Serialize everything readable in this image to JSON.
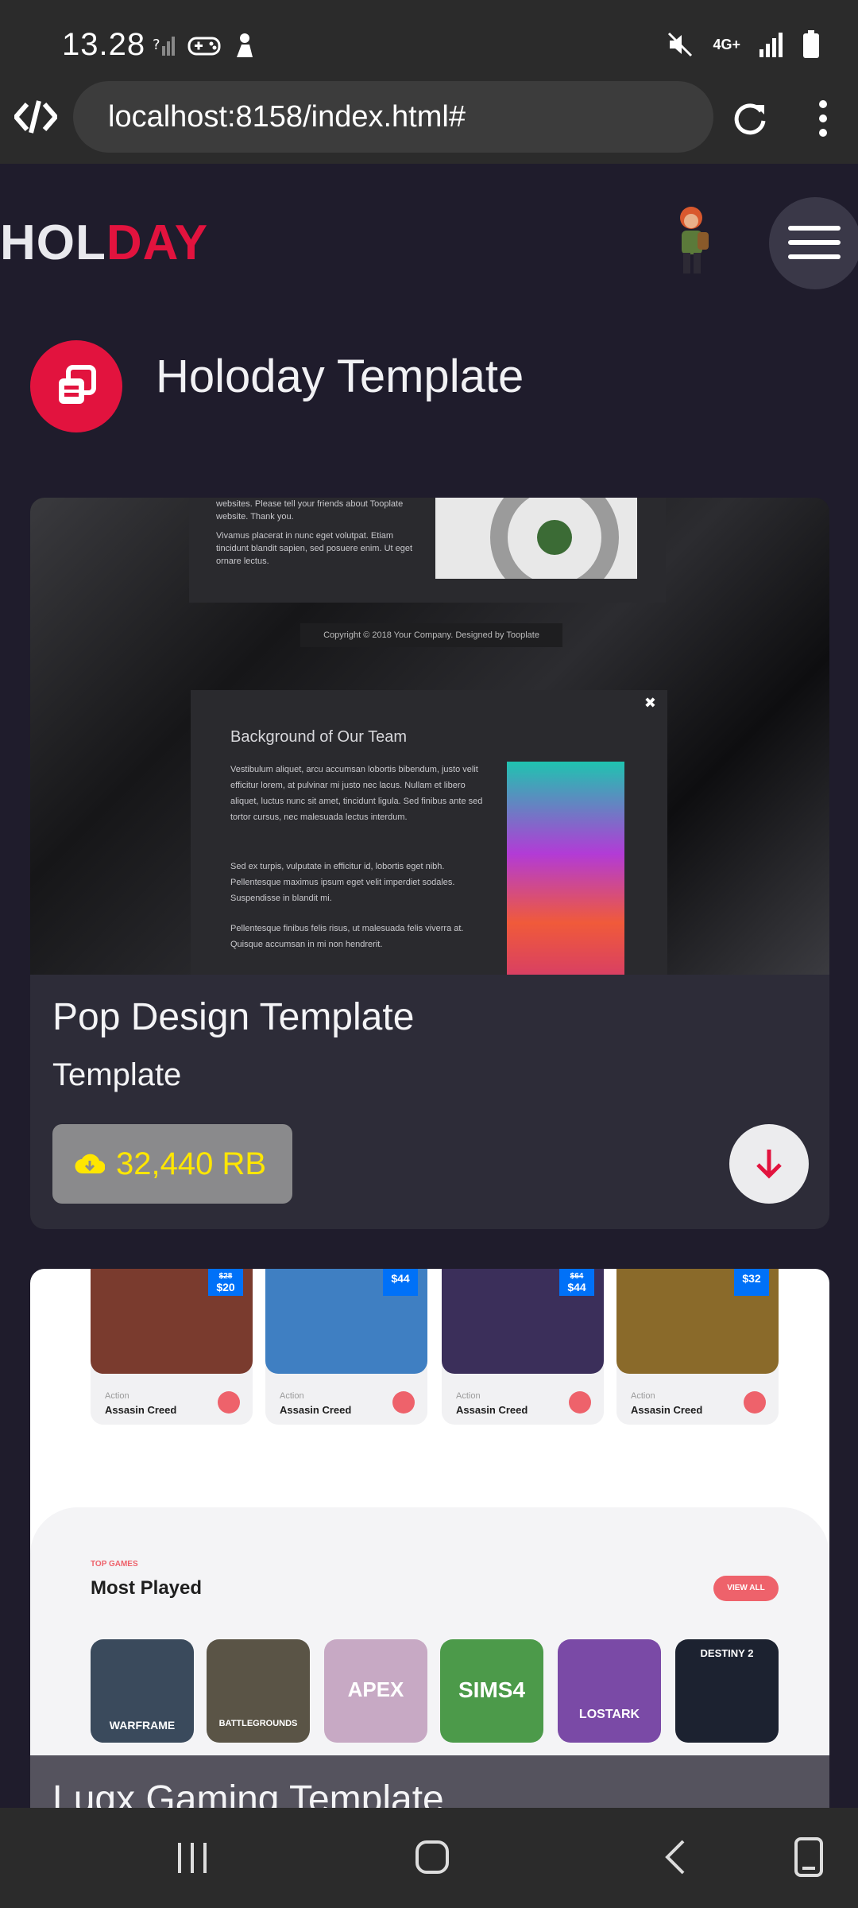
{
  "status_bar": {
    "time": "13.28",
    "network": "4G+"
  },
  "browser": {
    "url": "localhost:8158/index.html#"
  },
  "header": {
    "logo_part1": "HOL",
    "logo_part2": "DAY"
  },
  "section": {
    "title": "Holoday Template"
  },
  "cards": [
    {
      "title": "Pop Design Template",
      "subtitle": "Template",
      "downloads": "32,440 RB",
      "preview": {
        "top_text": "websites. Please tell your friends about Tooplate website. Thank you.",
        "top_text2": "Vivamus placerat in nunc eget volutpat. Etiam tincidunt blandit sapien, sed posuere enim. Ut eget ornare lectus.",
        "copyright": "Copyright © 2018 Your Company. Designed by Tooplate",
        "modal_title": "Background of Our Team",
        "modal_p1": "Vestibulum aliquet, arcu accumsan lobortis bibendum, justo velit efficitur lorem, at pulvinar mi justo nec lacus. Nullam et libero aliquet, luctus nunc sit amet, tincidunt ligula. Sed finibus ante sed tortor cursus, nec malesuada lectus interdum.",
        "modal_p2": "Sed ex turpis, vulputate in efficitur id, lobortis eget nibh. Pellentesque maximus ipsum eget velit imperdiet sodales. Suspendisse in blandit mi.",
        "modal_p3": "Pellentesque finibus felis risus, ut malesuada felis viverra at. Quisque accumsan in mi non hendrerit.",
        "close": "✖"
      }
    },
    {
      "title": "Lugx Gaming Template",
      "preview": {
        "games": [
          {
            "category": "Action",
            "name": "Assasin Creed",
            "price": "$20",
            "old_price": "$28",
            "color": "#7a3b2e"
          },
          {
            "category": "Action",
            "name": "Assasin Creed",
            "price": "$44",
            "old_price": "",
            "color": "#3f7fc2"
          },
          {
            "category": "Action",
            "name": "Assasin Creed",
            "price": "$44",
            "old_price": "$64",
            "color": "#3b2f5a"
          },
          {
            "category": "Action",
            "name": "Assasin Creed",
            "price": "$32",
            "old_price": "",
            "color": "#8a6a2a"
          }
        ],
        "section_label": "TOP GAMES",
        "section_title": "Most Played",
        "view_all": "VIEW ALL",
        "thumbs": [
          {
            "label": "WARFRAME",
            "color": "#3a4a5c"
          },
          {
            "label": "BATTLEGROUNDS",
            "color": "#5a5446"
          },
          {
            "label": "APEX",
            "color": "#c7a9c4"
          },
          {
            "label": "SIMS4",
            "color": "#4c9a4a"
          },
          {
            "label": "LOSTARK",
            "color": "#7a4aa6"
          },
          {
            "label": "DESTINY 2",
            "color": "#1c2230"
          }
        ]
      }
    }
  ]
}
